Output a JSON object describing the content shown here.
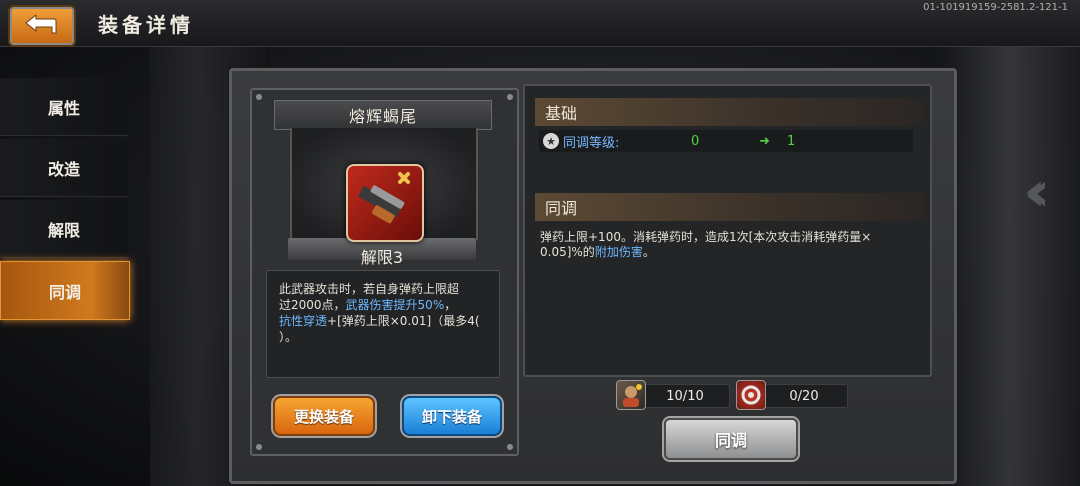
{
  "header": {
    "title": "装备详情",
    "version": "01-101919159-2581.2-121-1"
  },
  "sidenav": {
    "items": [
      {
        "label": "属性"
      },
      {
        "label": "改造"
      },
      {
        "label": "解限"
      },
      {
        "label": "同调",
        "active": true
      }
    ]
  },
  "weapon": {
    "name": "熔辉蝎尾",
    "limit_label": "解限3",
    "desc_line1": "此武器攻击时，若自身弹药上限超",
    "desc_line2a": "过2000点，",
    "desc_line2b": "武器伤害提升50%",
    "desc_line2c": "，",
    "desc_line3a": "抗性穿透",
    "desc_line3b": "+[弹药上限×0.01]（最多4(",
    "desc_line4": "）。"
  },
  "buttons": {
    "swap": "更换装备",
    "unequip": "卸下装备",
    "sync": "同调"
  },
  "base": {
    "header": "基础",
    "sync_level_label": "同调等级:",
    "current": "0",
    "next": "1"
  },
  "sync_section": {
    "header": "同调",
    "desc_a": "弹药上限+100。消耗弹药时，造成1次[本次攻击消耗弹药量×",
    "desc_b": "0.05]%的",
    "desc_c": "附加伤害",
    "desc_d": "。"
  },
  "materials": [
    {
      "icon": "character-portrait-icon",
      "count": "10/10"
    },
    {
      "icon": "gear-token-icon",
      "count": "0/20"
    }
  ],
  "colors": {
    "accent_orange": "#d07a1d",
    "link_blue": "#6fb6ff",
    "value_green": "#56d146"
  }
}
